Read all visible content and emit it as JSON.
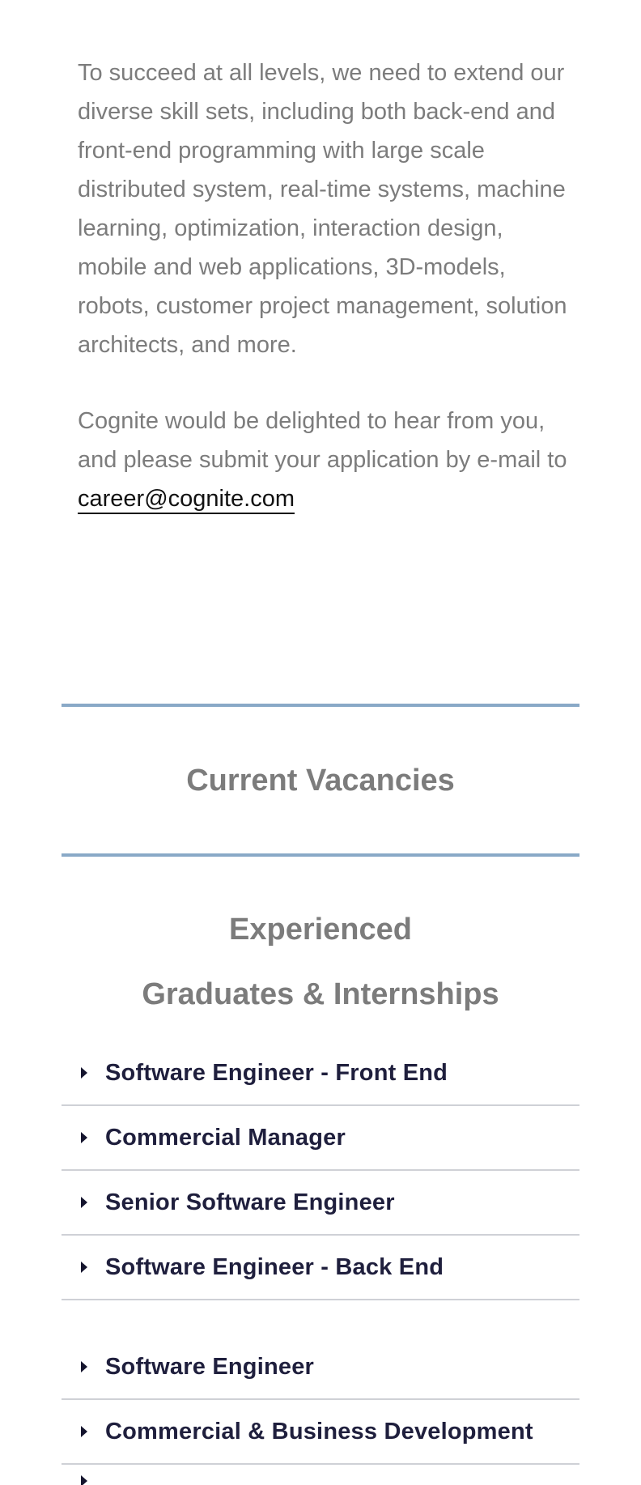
{
  "intro": {
    "paragraph1": "To succeed at all levels, we need to extend our diverse skill sets, including both back-end and front-end programming with large scale distributed system, real-time systems, machine learning, optimization, interaction design, mobile and web applications, 3D-models, robots, customer project management, solution architects, and more.",
    "paragraph2_prefix": "Cognite would be delighted to hear from you, and please submit your application by e-mail to ",
    "email": "career@cognite.com"
  },
  "vacancies": {
    "title": "Current Vacancies",
    "experienced_heading": "Experienced",
    "graduates_heading": "Graduates & Internships",
    "experienced_jobs": [
      {
        "label": "Software Engineer - Front End"
      },
      {
        "label": "Commercial Manager"
      },
      {
        "label": "Senior Software Engineer"
      },
      {
        "label": "Software Engineer - Back End"
      }
    ],
    "graduate_jobs": [
      {
        "label": "Software Engineer"
      },
      {
        "label": "Commercial & Business Development"
      }
    ]
  },
  "colors": {
    "body_text": "#7c7c7c",
    "rule_accent": "#89a9c7",
    "job_text": "#1f1f3d",
    "divider": "#cfd1d6"
  }
}
